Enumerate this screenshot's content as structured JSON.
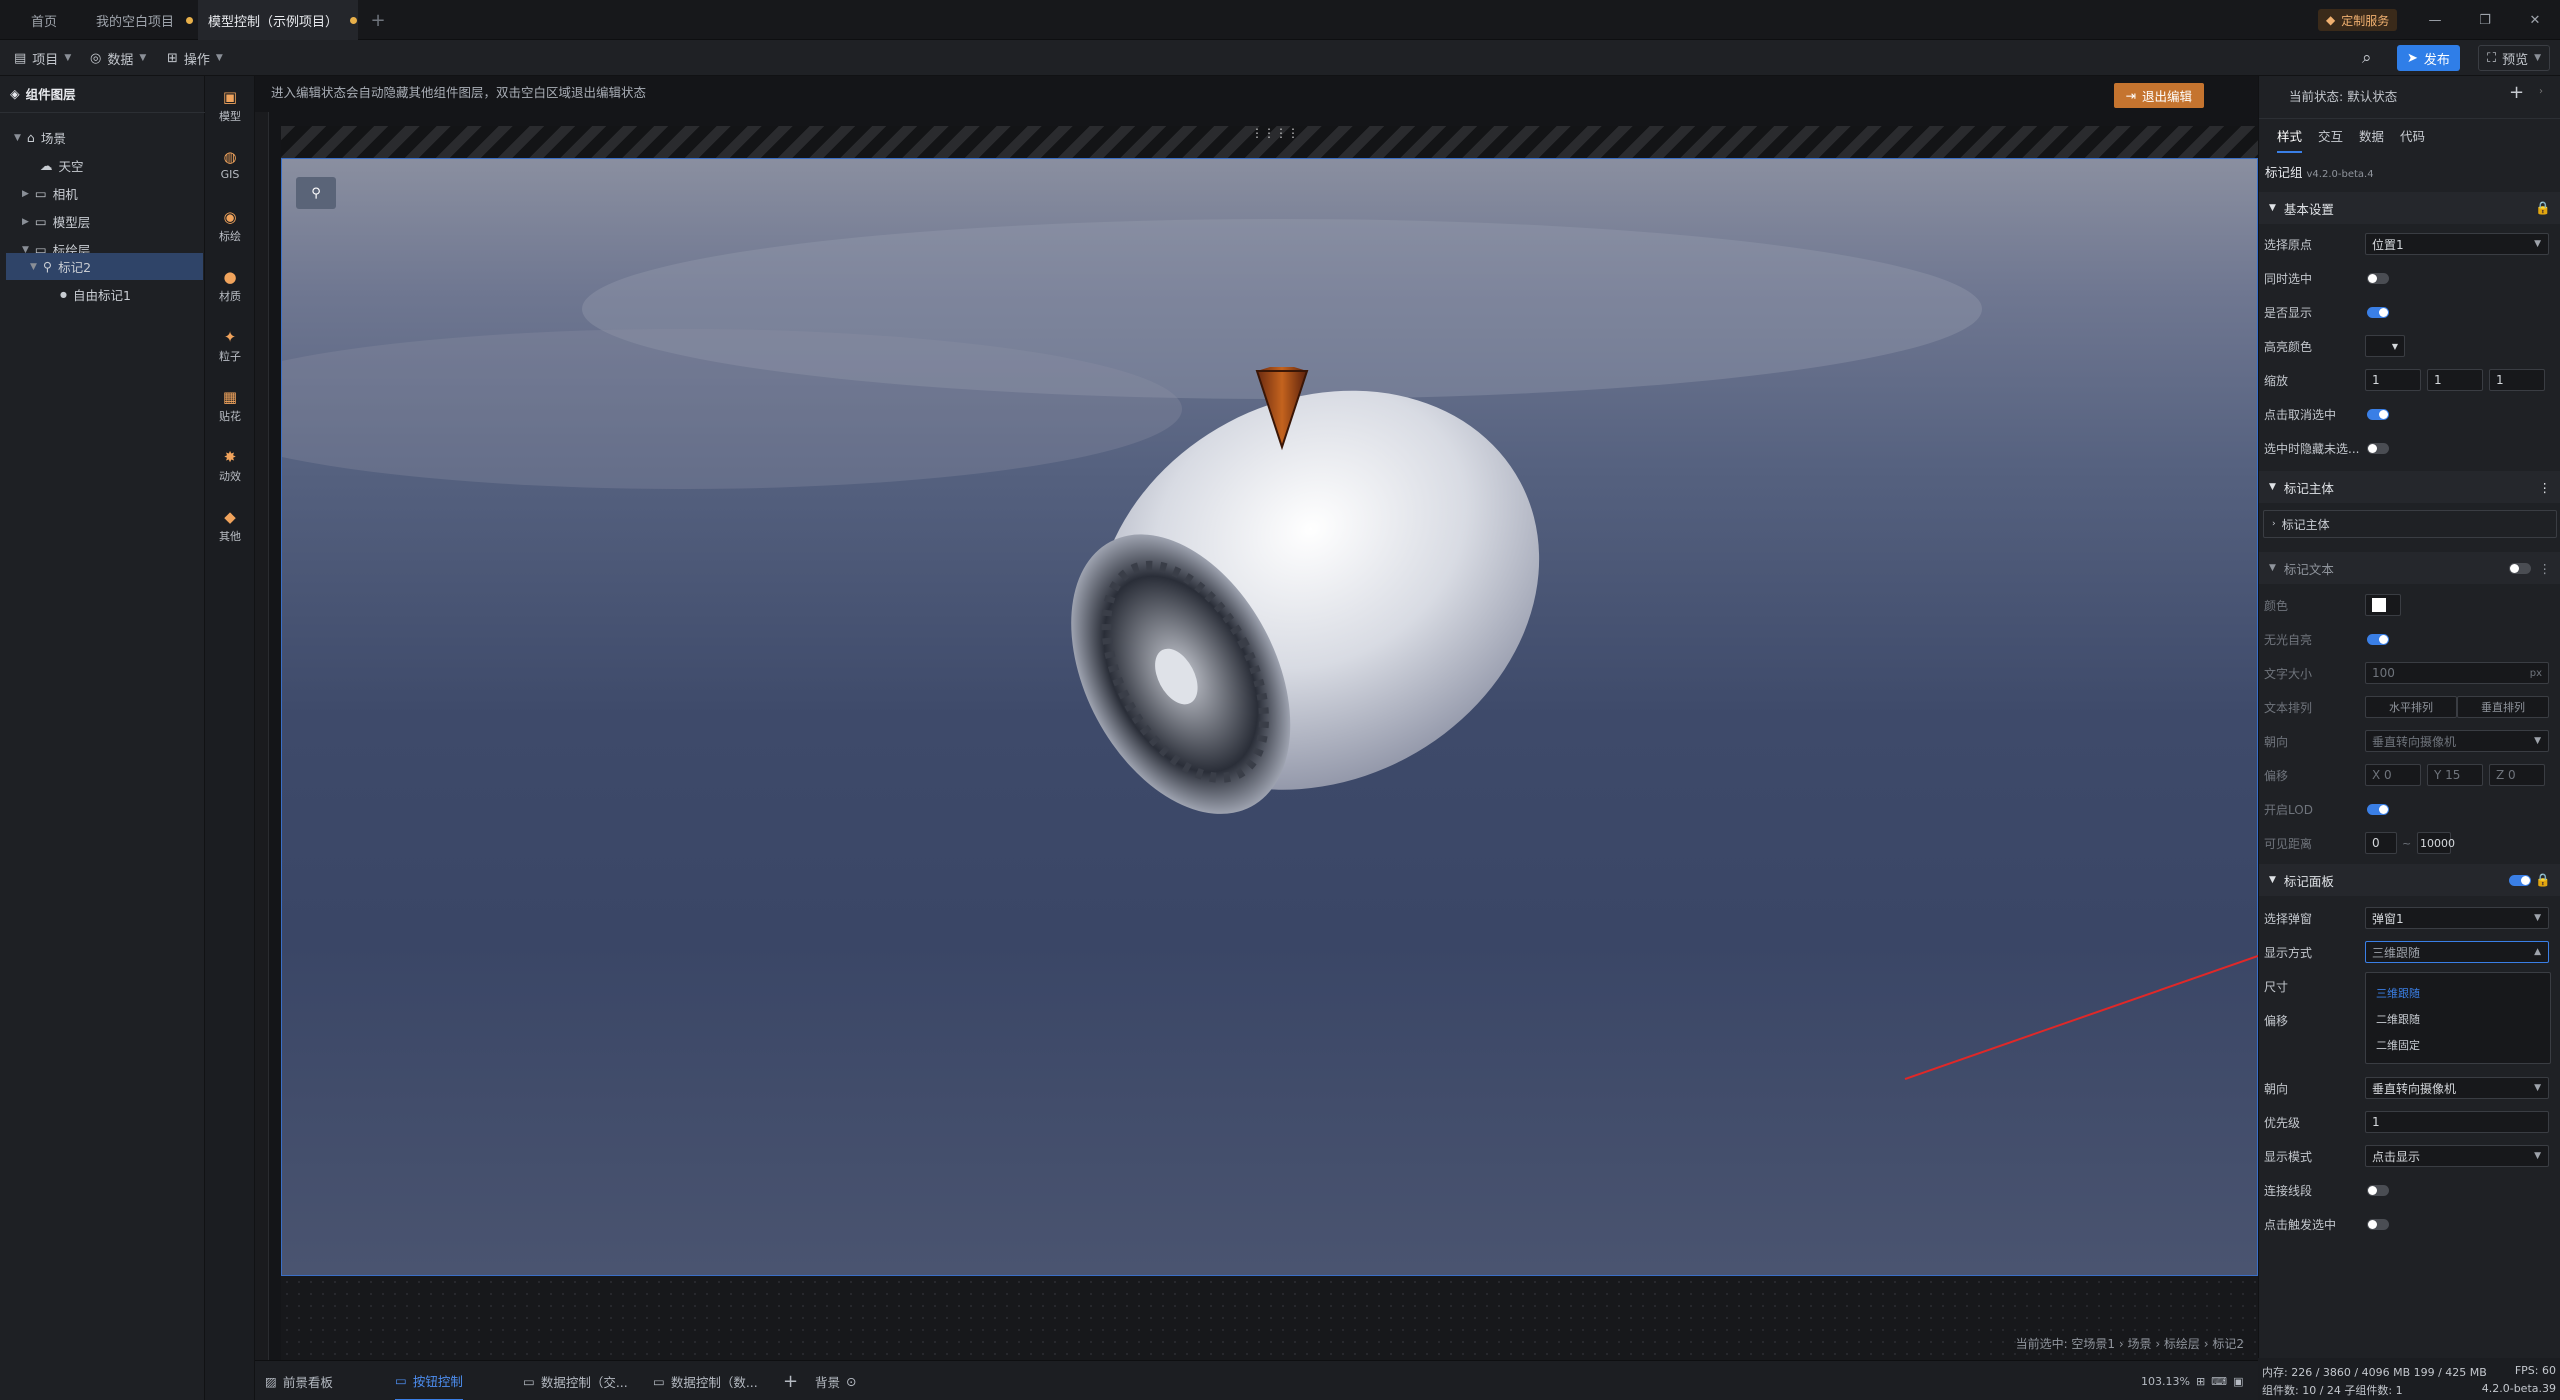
{
  "tabs": [
    {
      "label": "首页"
    },
    {
      "label": "我的空白项目"
    },
    {
      "label": "模型控制（示例项目）"
    }
  ],
  "titlebar": {
    "service_label": "定制服务",
    "min": "—",
    "restore": "❐",
    "close": "✕"
  },
  "toolbar": {
    "project": "项目",
    "data": "数据",
    "ops": "操作",
    "publish": "发布",
    "preview": "预览"
  },
  "layers": {
    "title": "组件图层",
    "items": [
      {
        "label": "场景"
      },
      {
        "label": "天空"
      },
      {
        "label": "相机"
      },
      {
        "label": "模型层"
      },
      {
        "label": "标绘层"
      },
      {
        "label": "标记2"
      },
      {
        "label": "自由标记1"
      }
    ]
  },
  "rail": [
    {
      "label": "模型"
    },
    {
      "label": "GIS"
    },
    {
      "label": "标绘"
    },
    {
      "label": "材质"
    },
    {
      "label": "粒子"
    },
    {
      "label": "贴花"
    },
    {
      "label": "动效"
    },
    {
      "label": "其他"
    }
  ],
  "viewport": {
    "hint": "进入编辑状态会自动隐藏其他组件图层，双击空白区域退出编辑状态",
    "exit_label": "退出编辑",
    "breadcrumb": "当前选中: 空场景1 › 场景 › 标绘层 › 标记2"
  },
  "bottom_tabs": [
    {
      "label": "前景看板"
    },
    {
      "label": "按钮控制"
    },
    {
      "label": "数据控制（交..."
    },
    {
      "label": "数据控制（数..."
    },
    {
      "label": "背景"
    }
  ],
  "right": {
    "state_label": "当前状态:",
    "state_value": "默认状态",
    "tabs": [
      "样式",
      "交互",
      "数据",
      "代码"
    ],
    "component": "标记组",
    "version": "v4.2.0-beta.4",
    "basic": {
      "title": "基本设置",
      "origin_label": "选择原点",
      "origin_value": "位置1",
      "multi": "同时选中",
      "show": "是否显示",
      "hl": "高亮颜色",
      "scale": "缩放",
      "s1": "1",
      "s2": "1",
      "s3": "1",
      "cancel": "点击取消选中",
      "hide": "选中时隐藏未选..."
    },
    "body": {
      "title": "标记主体",
      "sub": "标记主体"
    },
    "text": {
      "title": "标记文本",
      "color": "颜色",
      "glow": "无光自亮",
      "size": "文字大小",
      "size_val": "100",
      "size_unit": "px",
      "arr": "文本排列",
      "h": "水平排列",
      "v": "垂直排列",
      "orient": "朝向",
      "orient_val": "垂直转向摄像机",
      "offset": "偏移",
      "ox": "0",
      "oy": "15",
      "oz": "0",
      "lod": "开启LOD",
      "vis": "可见距离",
      "vmin": "0",
      "vmax": "10000",
      "sep": "~"
    },
    "panel": {
      "title": "标记面板",
      "popup": "选择弹窗",
      "popup_val": "弹窗1",
      "mode": "显示方式",
      "mode_val": "三维跟随",
      "size": "尺寸",
      "offset": "偏移",
      "options": [
        "三维跟随",
        "二维跟随",
        "二维固定"
      ],
      "orient": "朝向",
      "orient_val": "垂直转向摄像机",
      "prio": "优先级",
      "prio_val": "1",
      "disp": "显示模式",
      "disp_val": "点击显示",
      "line": "连接线段",
      "click": "点击触发选中"
    }
  },
  "status": {
    "mem": "内存: 226 / 3860 / 4096 MB  199 / 425 MB",
    "fps": "FPS: 60",
    "count": "组件数: 10 / 24   子组件数: 1",
    "ver": "4.2.0-beta.39",
    "zoom": "103.13%"
  }
}
